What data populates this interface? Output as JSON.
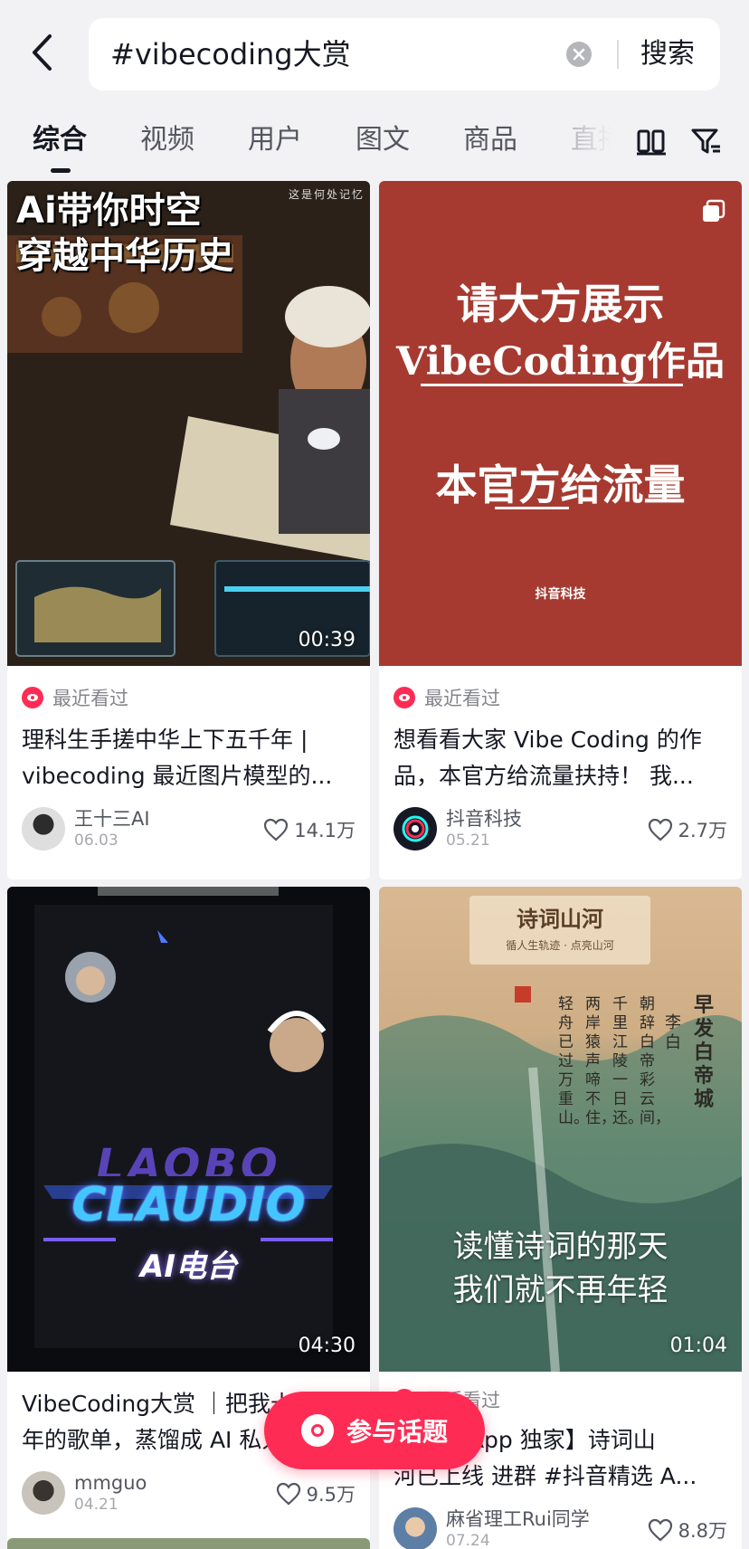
{
  "search": {
    "query": "#vibecoding大赏",
    "button_label": "搜索"
  },
  "tabs": [
    {
      "label": "综合",
      "active": true
    },
    {
      "label": "视频",
      "active": false
    },
    {
      "label": "用户",
      "active": false
    },
    {
      "label": "图文",
      "active": false
    },
    {
      "label": "商品",
      "active": false
    },
    {
      "label": "直播",
      "active": false
    }
  ],
  "cards": [
    {
      "thumb_title_line1": "Ai带你时空",
      "thumb_title_line2": "穿越中华历史",
      "thumb_corner_text": "这是何处记忆",
      "duration": "00:39",
      "seen_label": "最近看过",
      "title_line1": "理科生手搓中华上下五千年 |",
      "title_line2": "vibecoding 最近图片模型的...",
      "author": "王十三AI",
      "date": "06.03",
      "likes": "14.1万"
    },
    {
      "thumb_line1": "请大方展示",
      "thumb_line2": "VibeCoding作品",
      "thumb_line3": "本官方给流量",
      "thumb_brand": "抖音科技",
      "seen_label": "最近看过",
      "title_line1": "想看看大家 Vibe Coding 的作",
      "title_line2": "品，本官方给流量扶持！ 我...",
      "author": "抖音科技",
      "date": "05.21",
      "likes": "2.7万"
    },
    {
      "thumb_logo_line1": "LAOBO",
      "thumb_logo_line2": "CLAUDIO",
      "thumb_logo_line3": "AI电台",
      "duration": "04:30",
      "title_line1": "VibeCoding大赏 ｜把我十四",
      "title_line2": "年的歌单，蒸馏成 AI 私人...",
      "author": "mmguo",
      "date": "04.21",
      "likes": "9.5万"
    },
    {
      "thumb_header": "诗词山河",
      "thumb_subheader": "循人生轨迹 · 点亮山河",
      "thumb_poem_title": "早发白帝城",
      "thumb_poem_author": "李白",
      "thumb_verse1": "朝辞白帝彩云间，",
      "thumb_verse2": "千里江陵一日还。",
      "thumb_verse3": "两岸猿声啼不住，",
      "thumb_verse4": "轻舟已过万重山。",
      "thumb_caption_line1": "读懂诗词的那天",
      "thumb_caption_line2": "我们就不再年轻",
      "duration": "01:04",
      "seen_label": "最近看过",
      "title_line1": "【精选 App 独家】诗词山",
      "title_line2": "河已上线 进群 #抖音精选 A...",
      "author": "麻省理工Rui同学",
      "date": "07.24",
      "likes": "8.8万"
    }
  ],
  "fab_label": "参与话题",
  "colors": {
    "accent": "#fe2c55",
    "background": "#f2f2f4",
    "card_red": "#a63a30",
    "text_primary": "#161823",
    "text_secondary": "#85868c"
  }
}
